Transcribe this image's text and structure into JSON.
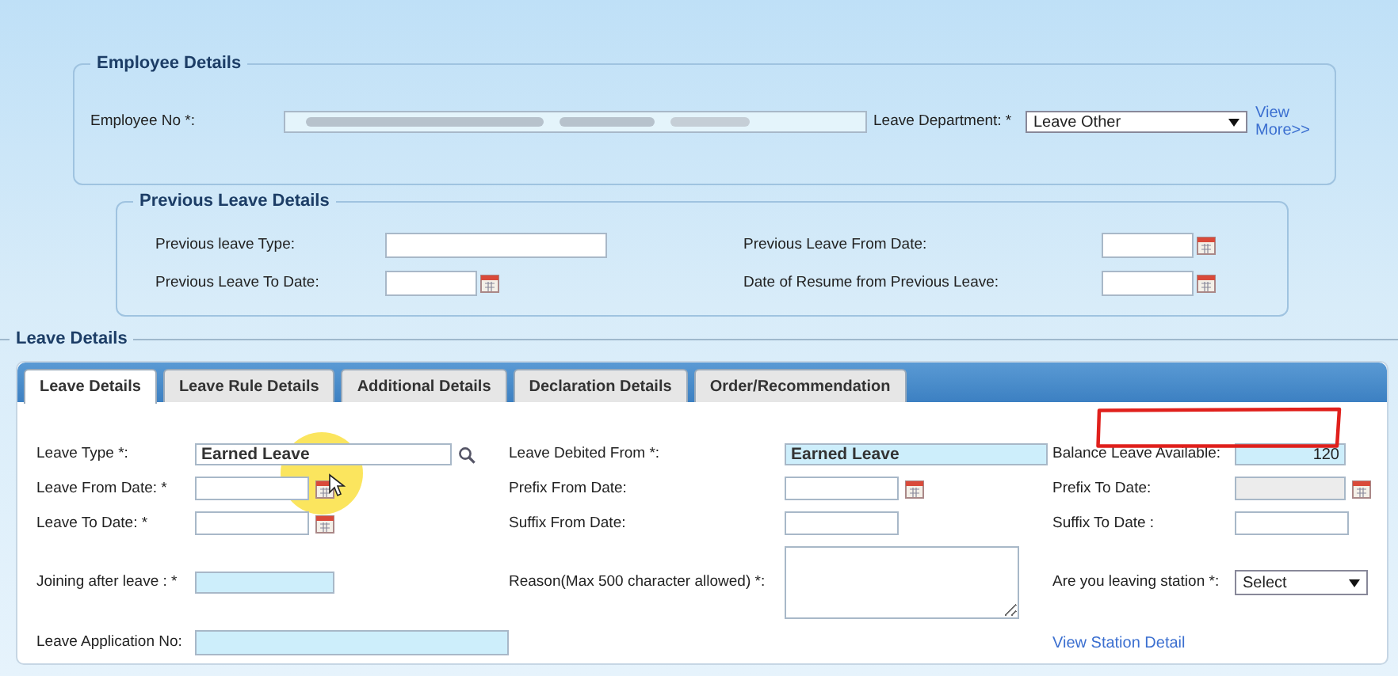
{
  "employee_details": {
    "legend": "Employee Details",
    "employee_label": "Employee No *:",
    "department_label": "Leave Department: *",
    "department_value": "Leave Other",
    "link": "View More>>"
  },
  "previous_leave": {
    "legend": "Previous Leave Details",
    "fields": [
      {
        "label": "Previous leave Type:",
        "kind": "text"
      },
      {
        "label": "Previous Leave From Date:",
        "kind": "date"
      },
      {
        "label": "Previous Leave To Date:",
        "kind": "date"
      },
      {
        "label": "Date of Resume from Previous Leave:",
        "kind": "date"
      }
    ]
  },
  "leave_details": {
    "legend": "Leave Details",
    "tabs": [
      {
        "label": "Leave Details",
        "selected": true
      },
      {
        "label": "Leave Rule Details",
        "selected": false
      },
      {
        "label": "Additional Details",
        "selected": false
      },
      {
        "label": "Declaration Details",
        "selected": false
      },
      {
        "label": "Order/Recommendation",
        "selected": false
      }
    ],
    "rows": [
      {
        "kind": "normal",
        "items": [
          {
            "kind": "lookup",
            "label": "Leave Type *:",
            "value": "Earned Leave"
          },
          {
            "kind": "prefilled",
            "label": "Leave Debited From *:",
            "value": "Earned Leave"
          },
          {
            "kind": "amount",
            "label": "Balance Leave Available:",
            "value": "120"
          }
        ]
      },
      {
        "kind": "normal",
        "items": [
          {
            "kind": "date",
            "label": "Leave From Date: *"
          },
          {
            "kind": "date",
            "label": "Prefix From Date:"
          },
          {
            "kind": "lockeddate",
            "label": "Prefix To Date:"
          }
        ]
      },
      {
        "kind": "normal",
        "items": [
          {
            "kind": "date",
            "label": "Leave To Date: *"
          },
          {
            "kind": "text",
            "label": "Suffix From Date:"
          },
          {
            "kind": "text",
            "label": "Suffix To Date :"
          }
        ]
      },
      {
        "kind": "tall",
        "items": [
          {
            "kind": "tinted",
            "label": "Joining after leave : *"
          },
          {
            "kind": "memo",
            "label": "Reason(Max 500 character allowed) *:"
          },
          {
            "kind": "dropdown",
            "label": "Are you leaving station *:",
            "value": "Select"
          }
        ]
      },
      {
        "kind": "normal",
        "items": [
          {
            "kind": "tintedwide",
            "label": "Leave Application No:"
          },
          {
            "kind": "link",
            "label": "View Station Detail"
          }
        ]
      }
    ]
  }
}
